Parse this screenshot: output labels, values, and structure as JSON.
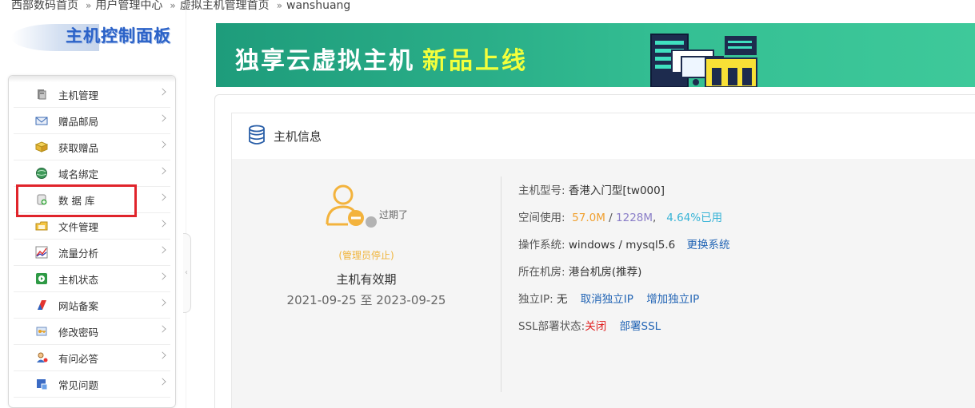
{
  "breadcrumb": {
    "items": [
      "西部数码首页",
      "用户管理中心",
      "虚拟主机管理首页",
      "wanshuang"
    ],
    "separator": "»"
  },
  "panel": {
    "title": "主机控制面板"
  },
  "sidebar": {
    "items": [
      {
        "label": "主机管理",
        "icon": "server-icon"
      },
      {
        "label": "赠品邮局",
        "icon": "mail-icon"
      },
      {
        "label": "获取赠品",
        "icon": "gift-box-icon"
      },
      {
        "label": "域名绑定",
        "icon": "globe-icon"
      },
      {
        "label": "数 据 库",
        "icon": "database-icon"
      },
      {
        "label": "文件管理",
        "icon": "folder-icon"
      },
      {
        "label": "流量分析",
        "icon": "chart-icon"
      },
      {
        "label": "主机状态",
        "icon": "status-icon"
      },
      {
        "label": "网站备案",
        "icon": "flag-icon"
      },
      {
        "label": "修改密码",
        "icon": "key-icon"
      },
      {
        "label": "有问必答",
        "icon": "user-help-icon"
      },
      {
        "label": "常见问题",
        "icon": "faq-icon"
      }
    ]
  },
  "banner": {
    "title": "独享云虚拟主机",
    "subtitle": "新品上线"
  },
  "host_info": {
    "heading": "主机信息",
    "status_text": "过期了",
    "admin_status": "(管理员停止)",
    "validity_label": "主机有效期",
    "validity_range": "2021-09-25 至 2023-09-25",
    "model_label": "主机型号:",
    "model_value": "香港入门型[tw000]",
    "space_label": "空间使用:",
    "space_used": "57.0M",
    "space_sep": "/",
    "space_total": "1228M",
    "space_comma": ",",
    "space_percent": "4.64%已用",
    "os_label": "操作系统:",
    "os_value": "windows / mysql5.6",
    "os_change": "更换系统",
    "room_label": "所在机房:",
    "room_value": "港台机房(推荐)",
    "ip_label": "独立IP:",
    "ip_value": "无",
    "ip_cancel": "取消独立IP",
    "ip_add": "增加独立IP",
    "ssl_label": "SSL部署状态:",
    "ssl_value": "关闭",
    "ssl_deploy": "部署SSL"
  },
  "colors": {
    "accent_green": "#2aae88",
    "link_blue": "#2365b5",
    "highlight_red": "#e0242b",
    "orange": "#f0a030"
  }
}
